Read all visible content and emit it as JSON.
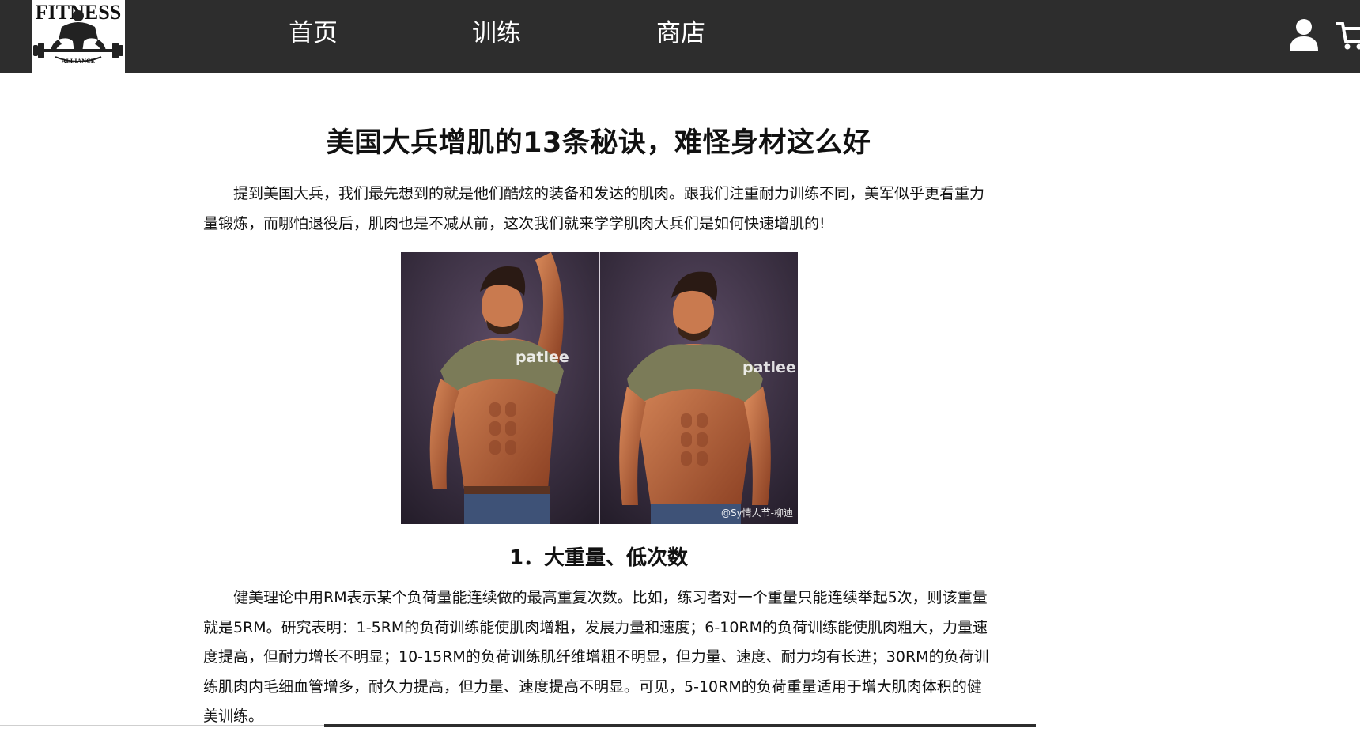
{
  "nav": {
    "logo_text_top": "FITNESS",
    "logo_text_bottom": "ALLIANCE",
    "links": [
      {
        "label": "首页"
      },
      {
        "label": "训练"
      },
      {
        "label": "商店"
      }
    ],
    "user_icon": "user-icon",
    "cart_icon": "cart-icon",
    "background": "#2d2d2d"
  },
  "article": {
    "title": "美国大兵增肌的13条秘诀，难怪身材这么好",
    "intro": "提到美国大兵，我们最先想到的就是他们酷炫的装备和发达的肌肉。跟我们注重耐力训练不同，美军似乎更看重力量锻炼，而哪怕退役后，肌肉也是不减从前，这次我们就来学学肌肉大兵们是如何快速增肌的!",
    "figure": {
      "watermark_left": "patlee",
      "watermark_right": "patlee",
      "credit": "@Sy情人节-柳迪"
    },
    "section1": {
      "heading": "1．大重量、低次数",
      "body": "健美理论中用RM表示某个负荷量能连续做的最高重复次数。比如，练习者对一个重量只能连续举起5次，则该重量就是5RM。研究表明：1-5RM的负荷训练能使肌肉增粗，发展力量和速度；6-10RM的负荷训练能使肌肉粗大，力量速度提高，但耐力增长不明显；10-15RM的负荷训练肌纤维增粗不明显，但力量、速度、耐力均有长进；30RM的负荷训练肌肉内毛细血管增多，耐久力提高，但力量、速度提高不明显。可见，5-10RM的负荷重量适用于增大肌肉体积的健美训练。"
    }
  }
}
